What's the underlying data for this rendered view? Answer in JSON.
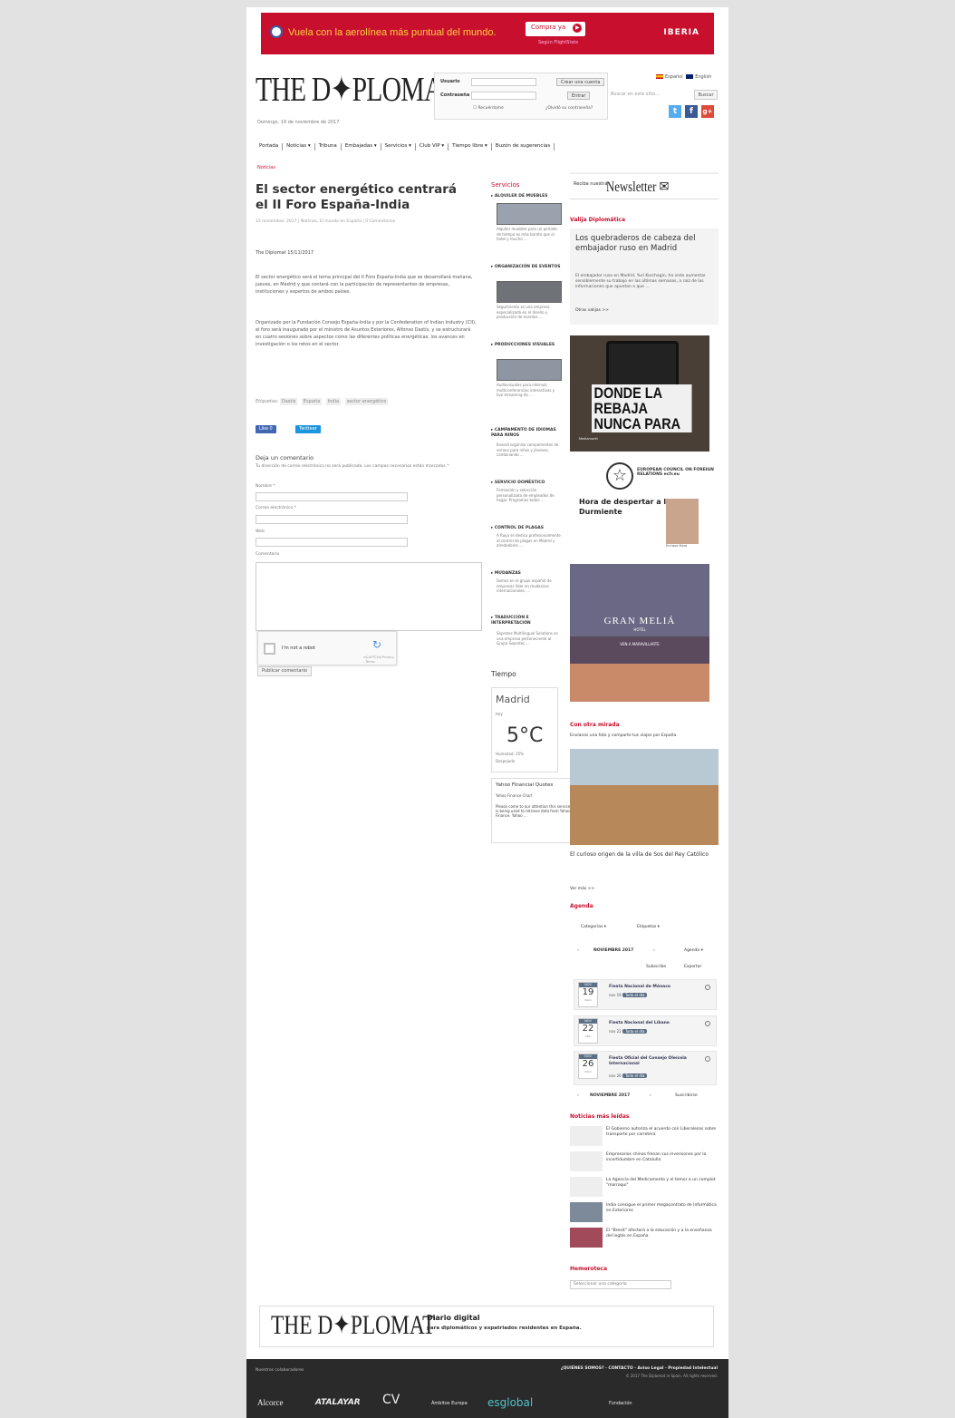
{
  "banner": {
    "text": "Vuela con la aerolínea más puntual del mundo.",
    "cta": "Compra ya",
    "subtext": "Según FlightStats",
    "brand": "IBERIA"
  },
  "header": {
    "logo": "THE D✦PLOMAT",
    "date": "Domingo, 19 de noviembre de 2017"
  },
  "login": {
    "user_label": "Usuario",
    "pass_label": "Contraseña",
    "create": "Crear una cuenta",
    "enter": "Entrar",
    "remember": "Recuérdame",
    "forgot": "¿Olvidó su contraseña?"
  },
  "lang": {
    "es": "Español",
    "en": "English"
  },
  "search": {
    "placeholder": "Buscar en este sitio...",
    "button": "Buscar"
  },
  "social": {
    "twitter": "t",
    "facebook": "f",
    "gplus": "g+"
  },
  "nav": [
    "Portada",
    "Noticias ▾",
    "Tribuna",
    "Embajadas ▾",
    "Servicios ▾",
    "Club VIP ▾",
    "Tiempo libre ▾",
    "Buzón de sugerencias"
  ],
  "breadcrumb": "Noticias",
  "article": {
    "title": "El sector energético centrará el II Foro España-India",
    "meta": "15 noviembre, 2017 | Noticias, El mundo en España | 0 Comentarios",
    "byline": "The Diplomat  15/11/2017",
    "p1": "El sector energético será el tema principal del II Foro España-India que se desarrollará mañana, jueves, en Madrid y que contará con la participación de representantes de empresas, instituciones y expertos de ambos países.",
    "p2": "Organizado por la Fundación Consejo España-India y por la Confederation of Indian Industry (CII), el foro será inaugurado por el ministro de Asuntos Exteriores, Alfonso Dastis, y se estructurará en cuatro sesiones sobre aspectos como las diferentes políticas energéticas, los avances en investigación o los retos en el sector.",
    "tags_label": "Etiquetas:",
    "tags": [
      "Dastis",
      "España",
      "India",
      "sector energético"
    ],
    "like": "Like 0",
    "tweet": "Twittear"
  },
  "comments": {
    "heading": "Deja un comentario",
    "notice": "Tu dirección de correo electrónico no será publicada. Los campos necesarios están marcados *",
    "name": "Nombre *",
    "email": "Correo electrónico *",
    "web": "Web",
    "comment": "Comentario",
    "captcha": "I'm not a robot",
    "captcha_small": "reCAPTCHA Privacy - Terms",
    "submit": "Publicar comentario"
  },
  "services": {
    "heading": "Servicios",
    "items": [
      {
        "title": "▸ ALQUILER DE MUEBLES",
        "desc": "Alquiler muebles para un periodo de tiempo es más barato que el hotel y mucho ..."
      },
      {
        "title": "▸ ORGANIZACIÓN DE EVENTOS",
        "desc": "Seguimiento es una empresa especializada en el diseño y producción de eventos ..."
      },
      {
        "title": "▸ PRODUCCIONES VISUALES",
        "desc": "Audiovisuales para internet, multiconferencias interactivas y live streaming de ..."
      },
      {
        "title": "▸ CAMPAMENTO DE IDIOMAS PARA NIÑOS",
        "desc": "Enerall organiza campamentos de verano para niños y jóvenes, combinando ..."
      },
      {
        "title": "▸ SERVICIO DOMÉSTICO",
        "desc": "Formación y selección personalizada de empleados de hogar. Programas todos ..."
      },
      {
        "title": "▸ CONTROL DE PLAGAS",
        "desc": "A Raya se dedica profesionalmente al control de plagas en Madrid y alrededores. ..."
      },
      {
        "title": "▸ MUDANZAS",
        "desc": "Somos en el grupo español de empresas líder en mudanzas internacionales, ..."
      },
      {
        "title": "▸ TRADUCCIÓN E INTERPRETACIÓN",
        "desc": "Seprotec Multilingual Solutions es una empresa perteneciente al Grupo Seprotec ..."
      }
    ]
  },
  "weather": {
    "heading": "Tiempo",
    "city": "Madrid",
    "sub": "Hoy",
    "temp": "5°C",
    "humidity": "Humedad: 35%",
    "state": "Despejado"
  },
  "yahoo": {
    "heading": "Yahoo Financial Quotes",
    "sub": "Yahoo Finance Chart",
    "body": "Please come to our attention this service is being used to retrieve data from Yahoo Finance. Yahoo ..."
  },
  "newsletter": {
    "pre": "Reciba nuestra",
    "title": "Newsletter ✉"
  },
  "valija": {
    "heading": "Valija Diplomática",
    "title": "Los quebraderos de cabeza del embajador ruso en Madrid",
    "desc": "El embajador ruso en Madrid, Yuri Korchagin, ha visto aumentar sensiblemente su trabajo en las últimas semanas, a raíz de las informaciones que apuntan a que ...",
    "more": "Otras valijas >>"
  },
  "ad_rebaja": {
    "text": "DONDE LA REBAJA NUNCA PARA",
    "sub": "Mediamarkt"
  },
  "ad_ecfr": {
    "org": "EUROPEAN COUNCIL ON FOREIGN RELATIONS ecfr.eu",
    "quote": "Hora de despertar a la Bella Durmiente",
    "person": "Enrique Mora"
  },
  "ad_melia": {
    "title": "GRAN MELIÁ",
    "sub": "HOTEL",
    "tagline": "VEN A MARAVILLARTE"
  },
  "otra": {
    "heading": "Con otra mirada",
    "sub": "Envíanos una foto y comparte tus viajes por España",
    "caption": "El curioso origen de la villa de Sos del Rey Católico",
    "more": "Ver más >>"
  },
  "agenda": {
    "heading": "Agenda",
    "cat": "Categorías ▾",
    "tags": "Etiquetas ▾",
    "month": "NOVIEMBRE 2017",
    "view": "Agenda ▾",
    "print": "Subscribe",
    "export": "Exportar",
    "events": [
      {
        "m": "NOV",
        "d": "19",
        "w": "Dom",
        "title": "Fiesta Nacional de Mónaco",
        "time": "nov 19",
        "badge": "Todo el día"
      },
      {
        "m": "NOV",
        "d": "22",
        "w": "Mié",
        "title": "Fiesta Nacional del Líbano",
        "time": "nov 22",
        "badge": "Todo el día"
      },
      {
        "m": "NOV",
        "d": "26",
        "w": "Dom",
        "title": "Fiesta Oficial del Consejo Oleícola Internacional",
        "time": "nov 26",
        "badge": "Todo el día"
      }
    ],
    "month2": "NOVIEMBRE 2017",
    "subscribe": "Suscribirse"
  },
  "mas_leidas": {
    "heading": "Noticias más leídas",
    "items": [
      "El Gobierno autoriza el acuerdo con Liberalesas sobre transporte por carretera",
      "Empresarios chinos frenan sus inversiones por la incertidumbre en Cataluña",
      "La Agencia del Medicamento y el temor a un complot \"marroquí\"",
      "India consigue el primer megacontrato de Informática en Exteriores",
      "El \"Brexit\" afectará a la educación y a la enseñanza del inglés en España"
    ]
  },
  "hemeroteca": {
    "heading": "Hemeroteca",
    "select": "Seleccionar una categoría"
  },
  "footer_box": {
    "logo": "THE D✦PLOMAT",
    "title": "Diario digital",
    "desc": "para diplomáticos y expatriados residentes en España."
  },
  "footer": {
    "collab": "Nuestros colaboradores",
    "links": "¿QUIÉNES SOMOS?  ·  CONTACTO  ·  Aviso Legal  ·  Propiedad Intelectual",
    "copy": "© 2017 The Diplomat in Spain. All rights reserved.",
    "partners": [
      "Alcorce",
      "ATALAYAR",
      "CV",
      "Ámbitos Europa",
      "esglobal",
      "Fundación"
    ]
  },
  "colors": {
    "red": "#c8102e",
    "twitter": "#55acee",
    "facebook": "#3b5998",
    "gplus": "#dd4b39"
  }
}
